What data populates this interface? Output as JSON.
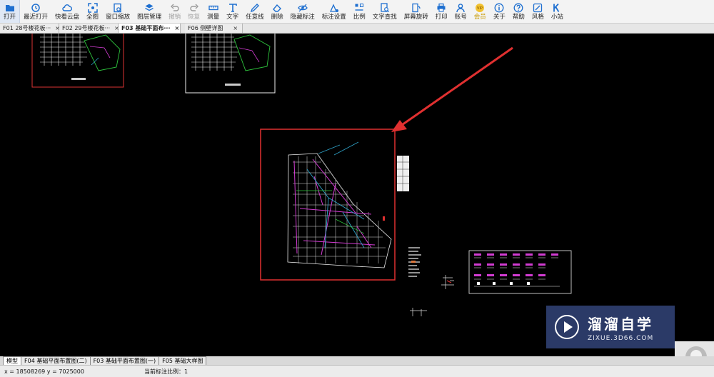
{
  "toolbar": {
    "buttons": [
      {
        "label": "打开",
        "icon": "folder-icon"
      },
      {
        "label": "最近打开",
        "icon": "history-icon"
      },
      {
        "label": "快看云盘",
        "icon": "cloud-icon"
      },
      {
        "label": "全图",
        "icon": "fit-all-icon"
      },
      {
        "label": "窗口缩放",
        "icon": "zoom-window-icon"
      },
      {
        "label": "图层管理",
        "icon": "layers-icon"
      },
      {
        "label": "撤销",
        "icon": "undo-icon"
      },
      {
        "label": "恢复",
        "icon": "redo-icon"
      },
      {
        "label": "测量",
        "icon": "measure-icon"
      },
      {
        "label": "文字",
        "icon": "text-icon"
      },
      {
        "label": "任意线",
        "icon": "pencil-icon"
      },
      {
        "label": "删除",
        "icon": "eraser-icon"
      },
      {
        "label": "隐藏标注",
        "icon": "eye-icon"
      },
      {
        "label": "标注设置",
        "icon": "annotation-settings-icon"
      },
      {
        "label": "比例",
        "icon": "scale-icon"
      },
      {
        "label": "文字查找",
        "icon": "text-search-icon"
      },
      {
        "label": "屏幕旋转",
        "icon": "rotate-screen-icon"
      },
      {
        "label": "打印",
        "icon": "printer-icon"
      },
      {
        "label": "账号",
        "icon": "user-icon"
      },
      {
        "label": "会员",
        "icon": "vip-icon"
      },
      {
        "label": "关于",
        "icon": "info-icon"
      },
      {
        "label": "帮助",
        "icon": "help-icon"
      },
      {
        "label": "风格",
        "icon": "style-icon"
      },
      {
        "label": "小站",
        "icon": "k-site-icon"
      }
    ]
  },
  "file_tabs": [
    {
      "label": "F01  28号楼花板···"
    },
    {
      "label": "F02  29号楼花板···"
    },
    {
      "label": "F03  基础平面布···"
    },
    {
      "label": "F06  侧壁详图"
    }
  ],
  "tab_close_glyph": "×",
  "sheet_tabs": [
    {
      "label": "模型"
    },
    {
      "label": "F04 基础平面布置图(二)"
    },
    {
      "label": "F03 基础平面布置图(一)"
    },
    {
      "label": "F05 基础大样图"
    }
  ],
  "status": {
    "coords": "x = 18508269  y = 7025000",
    "scale_text": "当前标注比例：1"
  },
  "watermark": {
    "title": "溜溜自学",
    "url": "ZIXUE.3D66.COM"
  },
  "colors": {
    "accent": "#1e6fd0",
    "highlight_box": "#e03030",
    "arrow": "#e03030",
    "watermark_bg": "#2b3a67"
  }
}
